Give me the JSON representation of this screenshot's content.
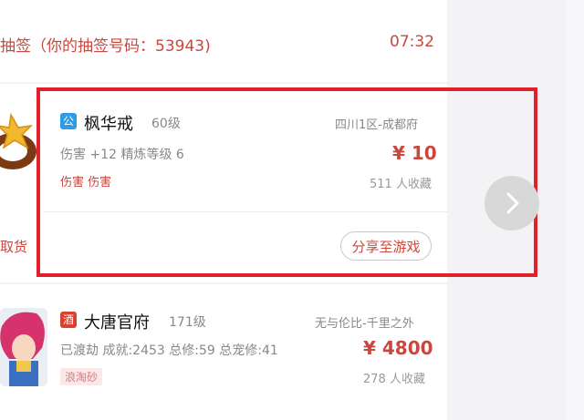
{
  "lottery_row": {
    "text": "抽签（你的抽签号码：53943)",
    "time": "07:32"
  },
  "item1": {
    "badge": "公",
    "name": "枫华戒",
    "level": "60级",
    "server": "四川1区-成都府",
    "description": "伤害 +12 精炼等级 6",
    "price": "¥ 10",
    "tags": "伤害 伤害",
    "favorites": "511 人收藏",
    "share_label": "分享至游戏",
    "left_label": "取货"
  },
  "item2": {
    "badge": "酒",
    "name": "大唐官府",
    "level": "171级",
    "server": "无与伦比-千里之外",
    "description": "已渡劫 成就:2453 总修:59 总宠修:41",
    "price": "¥ 4800",
    "tag": "浪淘砂",
    "favorites": "278 人收藏"
  },
  "colors": {
    "accent_red": "#c8483f",
    "highlight_border": "#e0202a",
    "badge_blue": "#2d9be8",
    "badge_red": "#d9412f"
  },
  "icons": {
    "next": "chevron-right-icon"
  }
}
